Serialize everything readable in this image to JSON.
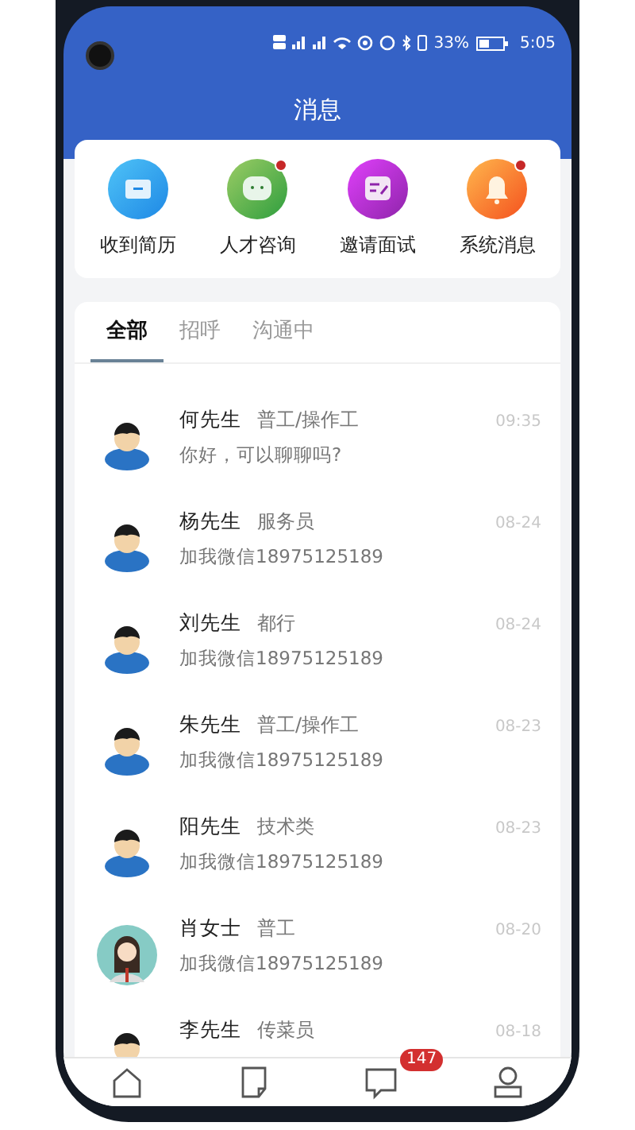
{
  "status_bar": {
    "battery": "33%",
    "time": "5:05"
  },
  "header": {
    "title": "消息"
  },
  "shortcuts": [
    {
      "label": "收到简历",
      "kind": "folder",
      "badge": false
    },
    {
      "label": "人才咨询",
      "kind": "chat",
      "badge": true
    },
    {
      "label": "邀请面试",
      "kind": "note",
      "badge": false
    },
    {
      "label": "系统消息",
      "kind": "bell",
      "badge": true
    }
  ],
  "tabs": [
    {
      "label": "全部",
      "selected": true
    },
    {
      "label": "招呼",
      "selected": false
    },
    {
      "label": "沟通中",
      "selected": false
    }
  ],
  "conversations": [
    {
      "name": "何先生",
      "job": "普工/操作工",
      "time": "09:35",
      "message": "你好，可以聊聊吗?",
      "kind": "male"
    },
    {
      "name": "杨先生",
      "job": "服务员",
      "time": "08-24",
      "message": "加我微信18975125189",
      "kind": "male"
    },
    {
      "name": "刘先生",
      "job": "都行",
      "time": "08-24",
      "message": "加我微信18975125189",
      "kind": "male"
    },
    {
      "name": "朱先生",
      "job": "普工/操作工",
      "time": "08-23",
      "message": "加我微信18975125189",
      "kind": "male"
    },
    {
      "name": "阳先生",
      "job": "技术类",
      "time": "08-23",
      "message": "加我微信18975125189",
      "kind": "male"
    },
    {
      "name": "肖女士",
      "job": "普工",
      "time": "08-20",
      "message": "加我微信18975125189",
      "kind": "female"
    },
    {
      "name": "李先生",
      "job": "传菜员",
      "time": "08-18",
      "kind": "male"
    }
  ],
  "bottom_nav": [
    {
      "kind": "home"
    },
    {
      "kind": "document"
    },
    {
      "kind": "chat",
      "badge": "147"
    },
    {
      "kind": "profile"
    }
  ]
}
